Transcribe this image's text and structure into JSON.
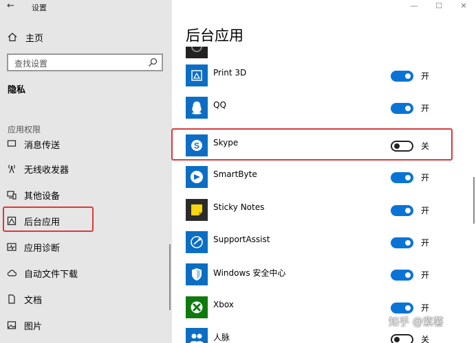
{
  "window": {
    "back": "←",
    "title": "设置",
    "controls": [
      "—",
      "☐",
      "✕"
    ]
  },
  "sidebar": {
    "home": "主页",
    "search_placeholder": "查找设置",
    "section": "隐私",
    "group": "应用权限",
    "items": [
      {
        "label": "消息传送",
        "icon": "message-icon"
      },
      {
        "label": "无线收发器",
        "icon": "radio-tower-icon"
      },
      {
        "label": "其他设备",
        "icon": "devices-icon"
      },
      {
        "label": "后台应用",
        "icon": "background-apps-icon"
      },
      {
        "label": "应用诊断",
        "icon": "diagnostics-icon"
      },
      {
        "label": "自动文件下载",
        "icon": "cloud-icon"
      },
      {
        "label": "文档",
        "icon": "document-icon"
      },
      {
        "label": "图片",
        "icon": "picture-icon"
      }
    ]
  },
  "main": {
    "title": "后台应用",
    "apps": [
      {
        "name": "Print 3D",
        "state": "开",
        "on": true,
        "icon": "print3d-icon",
        "color": "#0b6ec4"
      },
      {
        "name": "QQ",
        "state": "开",
        "on": true,
        "icon": "qq-icon",
        "color": "#0b6ec4"
      },
      {
        "name": "Skype",
        "state": "关",
        "on": false,
        "icon": "skype-icon",
        "color": "#0b6ec4"
      },
      {
        "name": "SmartByte",
        "state": "开",
        "on": true,
        "icon": "smartbyte-icon",
        "color": "#0b6ec4"
      },
      {
        "name": "Sticky Notes",
        "state": "开",
        "on": true,
        "icon": "sticky-notes-icon",
        "color": "#2b2b2b"
      },
      {
        "name": "SupportAssist",
        "state": "开",
        "on": true,
        "icon": "supportassist-icon",
        "color": "#0b6ec4"
      },
      {
        "name": "Windows 安全中心",
        "state": "开",
        "on": true,
        "icon": "shield-icon",
        "color": "#0b6ec4"
      },
      {
        "name": "Xbox",
        "state": "开",
        "on": true,
        "icon": "xbox-icon",
        "color": "#0e7a0d"
      },
      {
        "name": "人脉",
        "state": "关",
        "on": false,
        "icon": "people-icon",
        "color": "#0b6ec4"
      }
    ]
  },
  "watermark": "知乎 @紫薯"
}
